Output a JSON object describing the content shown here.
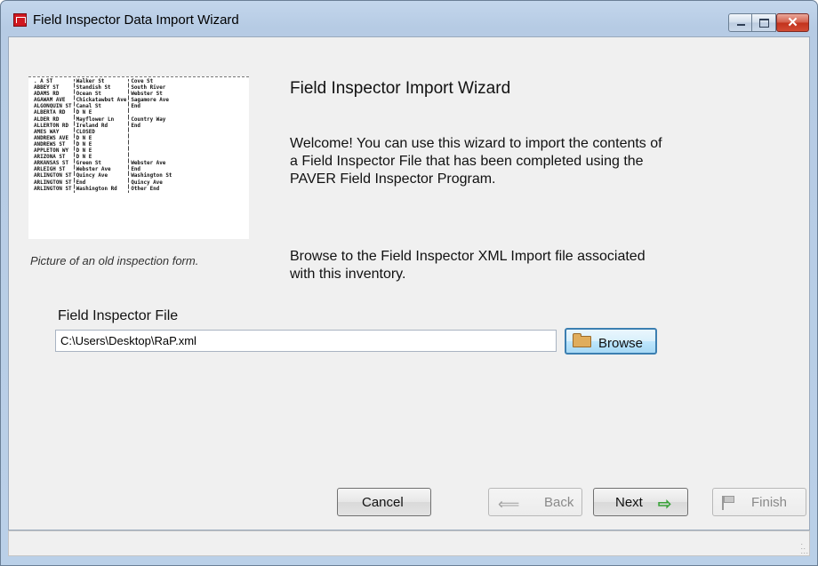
{
  "window": {
    "title": "Field Inspector Data Import Wizard"
  },
  "form_image": {
    "caption": "Picture of an old inspection form.",
    "rows": [
      [
        ". A ST",
        "Walker St",
        "Cove St"
      ],
      [
        "ABBEY ST",
        "Standish St",
        "South River"
      ],
      [
        "ADAMS RD",
        "Ocean St",
        "Webster St"
      ],
      [
        "AGAWAM AVE",
        "Chickatawbut Ave",
        "Sagamore Ave"
      ],
      [
        "ALGONQUIN ST",
        "Canal St",
        "End"
      ],
      [
        "ALBERTA RD",
        "D N E",
        ""
      ],
      [
        "ALDER RD",
        "Mayflower Ln",
        "Country Way"
      ],
      [
        "ALLERTON RD",
        "Ireland Rd",
        "End"
      ],
      [
        "AMES WAY",
        "CLOSED",
        ""
      ],
      [
        "ANDREWS AVE",
        "D N E",
        ""
      ],
      [
        "ANDREWS ST",
        "D N E",
        ""
      ],
      [
        "APPLETON WY",
        "D N E",
        ""
      ],
      [
        "ARIZONA ST",
        "D N E",
        ""
      ],
      [
        "ARKANSAS ST",
        "Green St",
        "Webster Ave"
      ],
      [
        "ARLEIGH ST",
        "Webster Ave",
        "End"
      ],
      [
        "ARLINGTON ST",
        "Quincy Ave",
        "Washington St"
      ],
      [
        "ARLINGTON ST",
        "End",
        "Quincy Ave"
      ],
      [
        "ARLINGTON ST",
        "Washington Rd",
        "Other End"
      ]
    ]
  },
  "heading": "Field Inspector Import Wizard",
  "welcome_text": "Welcome!  You can use this wizard to import the contents of a Field Inspector File that has been completed using the PAVER Field Inspector Program.",
  "browse_text": "Browse to the Field Inspector XML Import file associated with this inventory.",
  "file_field": {
    "label": "Field Inspector File",
    "value": "C:\\Users\\Desktop\\RaP.xml"
  },
  "buttons": {
    "browse": "Browse",
    "cancel": "Cancel",
    "back": "Back",
    "next": "Next",
    "finish": "Finish"
  },
  "icons": {
    "app": "field-inspector-app-icon",
    "folder": "folder-icon",
    "back": "arrow-left-icon",
    "next": "arrow-right-icon",
    "finish": "flag-icon"
  },
  "colors": {
    "next_arrow": "#3aa23a",
    "close_button": "#c2321c",
    "browse_focus": "#3c7fb1"
  }
}
